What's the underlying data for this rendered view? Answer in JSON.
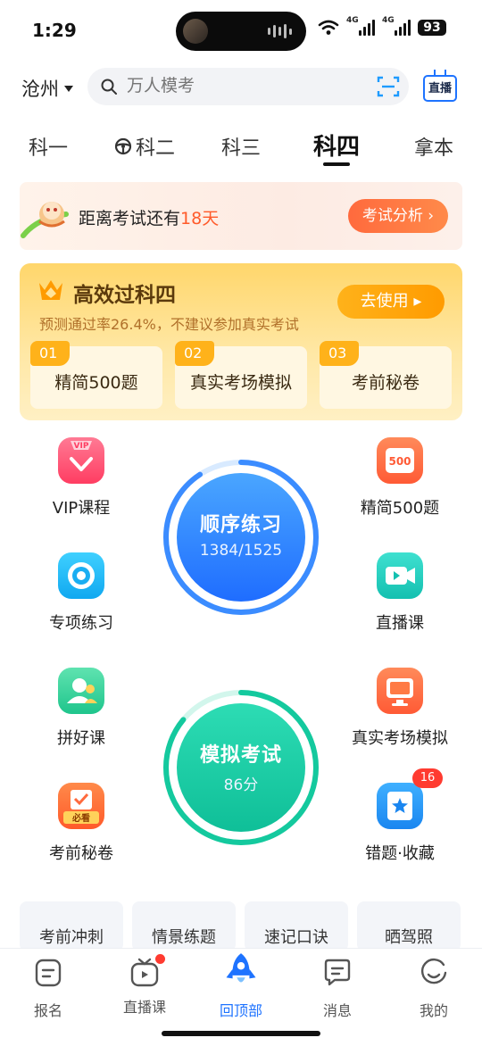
{
  "status_bar": {
    "time": "1:29",
    "signal_1": "4G",
    "signal_2": "4G",
    "battery": "93"
  },
  "header": {
    "city": "沧州",
    "search_placeholder": "万人模考",
    "live_label": "直播"
  },
  "tabs": [
    {
      "label": "科一",
      "active": false
    },
    {
      "label": "科二",
      "active": false,
      "icon": "steering-wheel-icon"
    },
    {
      "label": "科三",
      "active": false
    },
    {
      "label": "科四",
      "active": true
    },
    {
      "label": "拿本",
      "active": false
    }
  ],
  "exam_banner": {
    "text_prefix": "距离考试还有",
    "days": "18天",
    "button": "考试分析 ›"
  },
  "promo": {
    "title": "高效过科四",
    "subtitle": "预测通过率26.4%，不建议参加真实考试",
    "button": "去使用 ▸",
    "steps": [
      {
        "num": "01",
        "label": "精简500题"
      },
      {
        "num": "02",
        "label": "真实考场模拟"
      },
      {
        "num": "03",
        "label": "考前秘卷"
      }
    ]
  },
  "features_left": [
    {
      "label": "VIP课程",
      "icon": "vip-course-icon"
    },
    {
      "label": "专项练习",
      "icon": "target-icon"
    },
    {
      "label": "拼好课",
      "icon": "group-course-icon"
    },
    {
      "label": "考前秘卷",
      "icon": "must-see-icon",
      "icon_text": "必看"
    }
  ],
  "features_right": [
    {
      "label": "精简500题",
      "icon": "500-questions-icon",
      "icon_text": "500"
    },
    {
      "label": "直播课",
      "icon": "video-camera-icon"
    },
    {
      "label": "真实考场模拟",
      "icon": "monitor-icon"
    },
    {
      "label": "错题·收藏",
      "icon": "bookmark-star-icon",
      "badge": "16"
    }
  ],
  "practice_circle": {
    "title": "顺序练习",
    "progress_text": "1384/1525",
    "done": 1384,
    "total": 1525
  },
  "exam_circle": {
    "title": "模拟考试",
    "score_text": "86分",
    "score": 86,
    "max": 100
  },
  "quick_tags": [
    "考前冲刺",
    "情景练题",
    "速记口诀",
    "晒驾照"
  ],
  "bottom_nav": [
    {
      "label": "报名",
      "icon": "register-icon",
      "active": false
    },
    {
      "label": "直播课",
      "icon": "live-tv-icon",
      "active": false,
      "dot": true
    },
    {
      "label": "回顶部",
      "icon": "rocket-icon",
      "active": true
    },
    {
      "label": "消息",
      "icon": "message-icon",
      "active": false
    },
    {
      "label": "我的",
      "icon": "profile-icon",
      "active": false
    }
  ],
  "colors": {
    "accent": "#1e73ff",
    "orange": "#ff6a3d",
    "gold": "#ffb21a",
    "teal": "#13c8a0"
  }
}
